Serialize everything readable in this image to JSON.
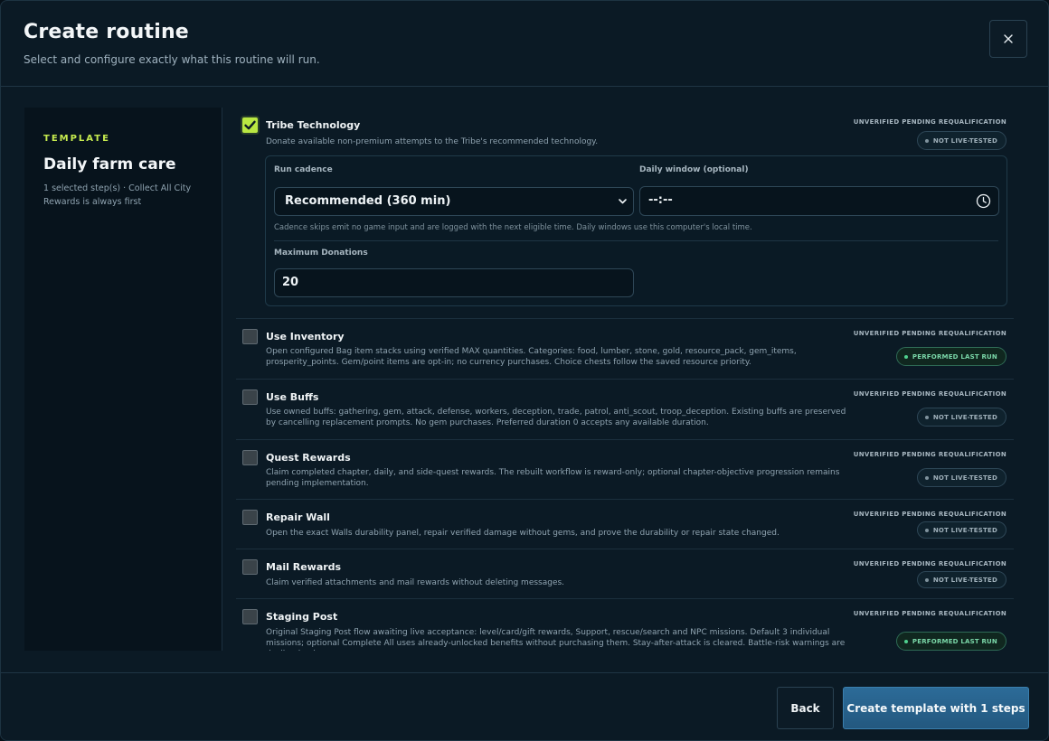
{
  "header": {
    "title": "Create routine",
    "subtitle": "Select and configure exactly what this routine will run."
  },
  "sidebar": {
    "kicker": "TEMPLATE",
    "name": "Daily farm care",
    "description": "1 selected step(s) · Collect All City Rewards is always first"
  },
  "steps": [
    {
      "title": "Tribe Technology",
      "checked": true,
      "description": "Donate available non-premium attempts to the Tribe's recommended technology.",
      "status": "UNVERIFIED PENDING REQUALIFICATION",
      "badge": "NOT LIVE-TESTED",
      "config": {
        "cadence_label": "Run cadence",
        "cadence_value": "Recommended (360 min)",
        "window_label": "Daily window (optional)",
        "window_value": "--:--",
        "hint": "Cadence skips emit no game input and are logged with the next eligible time. Daily windows use this computer's local time.",
        "max_label": "Maximum Donations",
        "max_value": "20"
      }
    },
    {
      "title": "Use Inventory",
      "checked": false,
      "description": "Open configured Bag item stacks using verified MAX quantities. Categories: food, lumber, stone, gold, resource_pack, gem_items, prosperity_points. Gem/point items are opt-in; no currency purchases. Choice chests follow the saved resource priority.",
      "status": "UNVERIFIED PENDING REQUALIFICATION",
      "badge": "PERFORMED LAST RUN"
    },
    {
      "title": "Use Buffs",
      "checked": false,
      "description": "Use owned buffs: gathering, gem, attack, defense, workers, deception, trade, patrol, anti_scout, troop_deception. Existing buffs are preserved by cancelling replacement prompts. No gem purchases. Preferred duration 0 accepts any available duration.",
      "status": "UNVERIFIED PENDING REQUALIFICATION",
      "badge": "NOT LIVE-TESTED"
    },
    {
      "title": "Quest Rewards",
      "checked": false,
      "description": "Claim completed chapter, daily, and side-quest rewards. The rebuilt workflow is reward-only; optional chapter-objective progression remains pending implementation.",
      "status": "UNVERIFIED PENDING REQUALIFICATION",
      "badge": "NOT LIVE-TESTED"
    },
    {
      "title": "Repair Wall",
      "checked": false,
      "description": "Open the exact Walls durability panel, repair verified damage without gems, and prove the durability or repair state changed.",
      "status": "UNVERIFIED PENDING REQUALIFICATION",
      "badge": "NOT LIVE-TESTED"
    },
    {
      "title": "Mail Rewards",
      "checked": false,
      "description": "Claim verified attachments and mail rewards without deleting messages.",
      "status": "UNVERIFIED PENDING REQUALIFICATION",
      "badge": "NOT LIVE-TESTED"
    },
    {
      "title": "Staging Post",
      "checked": false,
      "description": "Original Staging Post flow awaiting live acceptance: level/card/gift rewards, Support, rescue/search and NPC missions. Default 3 individual missions; optional Complete All uses already-unlocked benefits without purchasing them. Stay-after-attack is cleared. Battle-risk warnings are declined unless",
      "status": "UNVERIFIED PENDING REQUALIFICATION",
      "badge": "PERFORMED LAST RUN"
    }
  ],
  "footer": {
    "back_label": "Back",
    "create_label": "Create template with 1 steps"
  }
}
